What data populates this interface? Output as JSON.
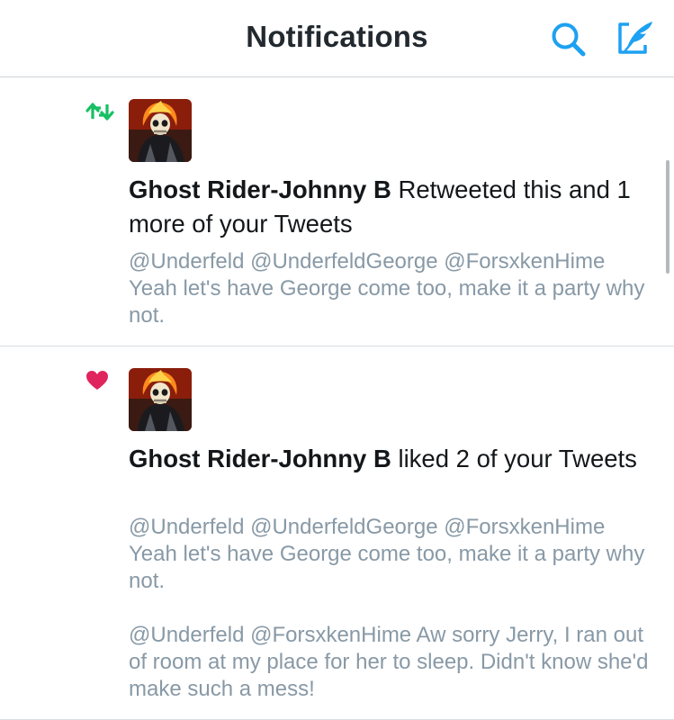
{
  "header": {
    "title": "Notifications",
    "search_icon": "search-icon",
    "compose_icon": "compose-icon",
    "accent_color": "#1da1f2"
  },
  "notifications": [
    {
      "type": "retweet",
      "icon": "retweet-icon",
      "icon_color": "#17bf63",
      "user_name": "Ghost Rider-Johnny B",
      "action_text": "Retweeted this and 1 more of your Tweets",
      "tweets": [
        "@Underfeld @UnderfeldGeorge @ForsxkenHime Yeah let's have George come too, make it a party why not."
      ]
    },
    {
      "type": "like",
      "icon": "heart-icon",
      "icon_color": "#e0245e",
      "user_name": "Ghost Rider-Johnny B",
      "action_text": "liked 2 of your Tweets",
      "tweets": [
        "@Underfeld @UnderfeldGeorge @ForsxkenHime Yeah let's have George come too, make it a party why not.",
        "@Underfeld @ForsxkenHime Aw sorry Jerry, I ran out of room at my place for her to sleep. Didn't know she'd make such a mess!"
      ]
    }
  ]
}
